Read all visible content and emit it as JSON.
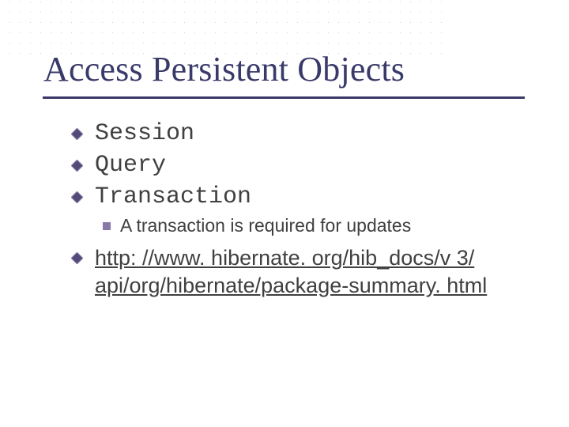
{
  "title": "Access Persistent Objects",
  "bullets": {
    "item0": "Session",
    "item1": "Query",
    "item2": "Transaction",
    "sub0": "A transaction is required for updates",
    "link": "http: //www. hibernate. org/hib_docs/v 3/ api/org/hibernate/package-summary. html"
  }
}
